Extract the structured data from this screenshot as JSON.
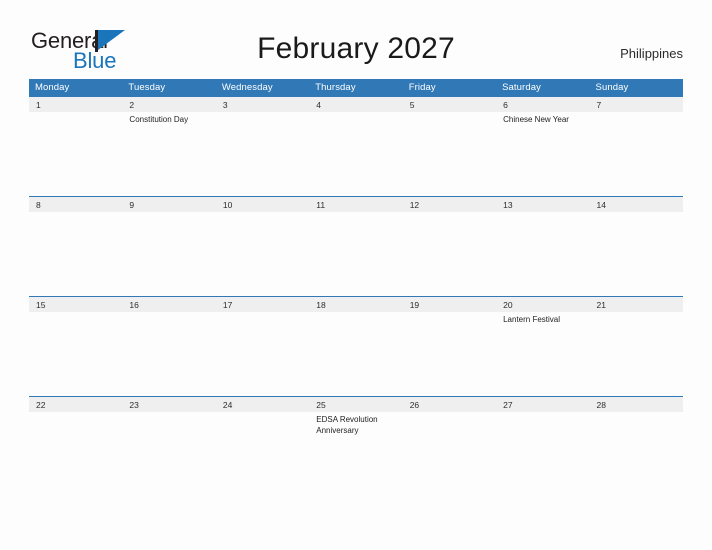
{
  "brand": {
    "name_part1": "General",
    "name_part2": "Blue",
    "flag_icon": "flag-icon"
  },
  "header": {
    "title": "February 2027",
    "country": "Philippines"
  },
  "calendar": {
    "weekdays": [
      "Monday",
      "Tuesday",
      "Wednesday",
      "Thursday",
      "Friday",
      "Saturday",
      "Sunday"
    ],
    "accent_color": "#3078b6",
    "number_band_color": "#efefef",
    "weeks": [
      {
        "days": [
          {
            "number": "1",
            "events": ""
          },
          {
            "number": "2",
            "events": "Constitution Day"
          },
          {
            "number": "3",
            "events": ""
          },
          {
            "number": "4",
            "events": ""
          },
          {
            "number": "5",
            "events": ""
          },
          {
            "number": "6",
            "events": "Chinese New Year"
          },
          {
            "number": "7",
            "events": ""
          }
        ]
      },
      {
        "days": [
          {
            "number": "8",
            "events": ""
          },
          {
            "number": "9",
            "events": ""
          },
          {
            "number": "10",
            "events": ""
          },
          {
            "number": "11",
            "events": ""
          },
          {
            "number": "12",
            "events": ""
          },
          {
            "number": "13",
            "events": ""
          },
          {
            "number": "14",
            "events": ""
          }
        ]
      },
      {
        "days": [
          {
            "number": "15",
            "events": ""
          },
          {
            "number": "16",
            "events": ""
          },
          {
            "number": "17",
            "events": ""
          },
          {
            "number": "18",
            "events": ""
          },
          {
            "number": "19",
            "events": ""
          },
          {
            "number": "20",
            "events": "Lantern Festival"
          },
          {
            "number": "21",
            "events": ""
          }
        ]
      },
      {
        "days": [
          {
            "number": "22",
            "events": ""
          },
          {
            "number": "23",
            "events": ""
          },
          {
            "number": "24",
            "events": ""
          },
          {
            "number": "25",
            "events": "EDSA Revolution Anniversary"
          },
          {
            "number": "26",
            "events": ""
          },
          {
            "number": "27",
            "events": ""
          },
          {
            "number": "28",
            "events": ""
          }
        ]
      }
    ]
  }
}
